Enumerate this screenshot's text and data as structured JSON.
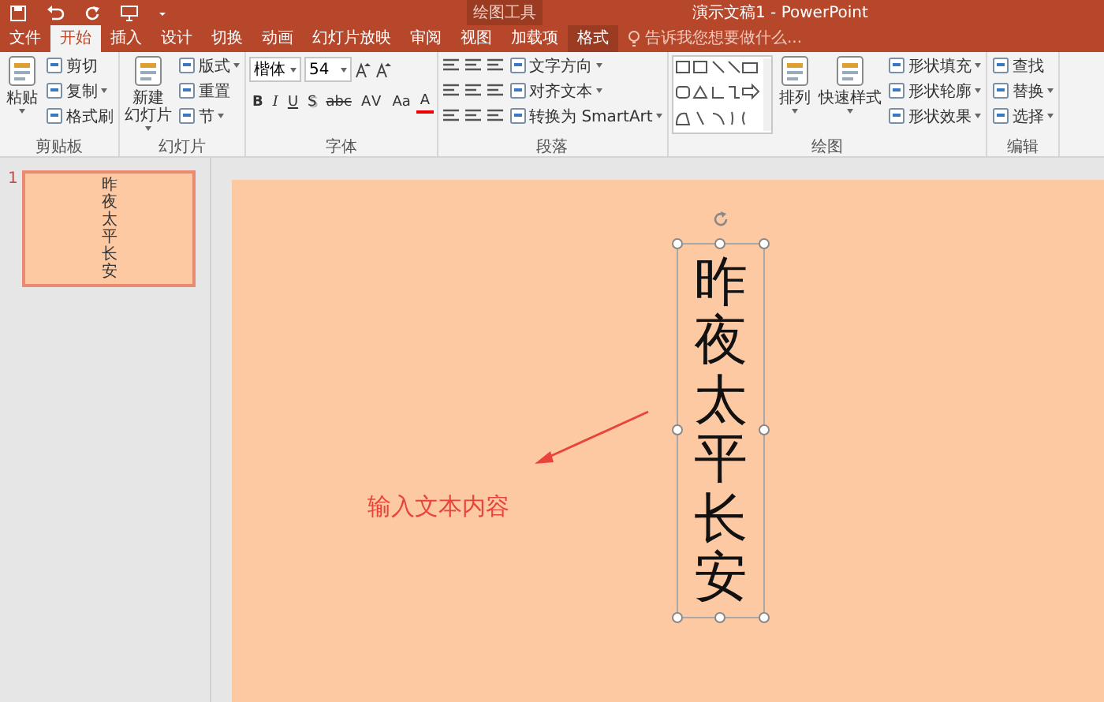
{
  "title_bar": {
    "contextual_label": "绘图工具",
    "title": "演示文稿1 - PowerPoint"
  },
  "tabs": [
    {
      "label": "文件",
      "selected": false,
      "contextual": false
    },
    {
      "label": "开始",
      "selected": true,
      "contextual": false
    },
    {
      "label": "插入",
      "selected": false,
      "contextual": false
    },
    {
      "label": "设计",
      "selected": false,
      "contextual": false
    },
    {
      "label": "切换",
      "selected": false,
      "contextual": false
    },
    {
      "label": "动画",
      "selected": false,
      "contextual": false
    },
    {
      "label": "幻灯片放映",
      "selected": false,
      "contextual": false
    },
    {
      "label": "审阅",
      "selected": false,
      "contextual": false
    },
    {
      "label": "视图",
      "selected": false,
      "contextual": false
    },
    {
      "label": "加载项",
      "selected": false,
      "contextual": false
    },
    {
      "label": "格式",
      "selected": false,
      "contextual": true
    }
  ],
  "search": {
    "placeholder": "告诉我您想要做什么..."
  },
  "ribbon": {
    "groups": [
      {
        "label": "剪贴板",
        "kind": "columns",
        "columns": [
          [
            {
              "kind": "large",
              "lines": [
                "粘贴"
              ],
              "dropdown": true
            }
          ],
          [
            {
              "kind": "small",
              "label": "剪切",
              "dropdown": false
            },
            {
              "kind": "small",
              "label": "复制",
              "dropdown": true
            },
            {
              "kind": "small",
              "label": "格式刷",
              "dropdown": false
            }
          ]
        ]
      },
      {
        "label": "幻灯片",
        "kind": "columns",
        "columns": [
          [
            {
              "kind": "large",
              "lines": [
                "新建",
                "幻灯片"
              ],
              "dropdown": true
            }
          ],
          [
            {
              "kind": "small",
              "label": "版式",
              "dropdown": true
            },
            {
              "kind": "small",
              "label": "重置",
              "dropdown": false
            },
            {
              "kind": "small",
              "label": "节",
              "dropdown": true
            }
          ]
        ]
      },
      {
        "label": "字体",
        "kind": "lines",
        "upper": [
          {
            "kind": "field",
            "label": "楷体",
            "dropdown": true
          },
          {
            "kind": "field",
            "label": "54",
            "dropdown": true
          },
          {
            "kind": "icons"
          }
        ],
        "lower": [
          {
            "kind": "bold",
            "label": "B"
          },
          {
            "kind": "italic",
            "label": "I"
          },
          {
            "kind": "underline",
            "label": "U"
          },
          {
            "kind": "shadow",
            "label": "S"
          },
          {
            "kind": "strike",
            "label": "abc"
          },
          {
            "kind": "spacing",
            "label": "AV"
          },
          {
            "kind": "plain",
            "label": "Aa"
          },
          {
            "kind": "color",
            "label": "A"
          }
        ]
      },
      {
        "label": "段落",
        "kind": "columns",
        "columns": [
          [
            {
              "kind": "icons"
            },
            {
              "kind": "icons"
            },
            {
              "kind": "icons"
            }
          ],
          [
            {
              "kind": "small",
              "label": "文字方向",
              "dropdown": true
            },
            {
              "kind": "small",
              "label": "对齐文本",
              "dropdown": true
            },
            {
              "kind": "small",
              "label": "转换为 SmartArt",
              "dropdown": true
            }
          ]
        ]
      },
      {
        "label": "绘图",
        "kind": "columns",
        "columns": [
          [
            {
              "kind": "gallery"
            }
          ],
          [
            {
              "kind": "large",
              "lines": [
                "排列"
              ],
              "dropdown": true
            }
          ],
          [
            {
              "kind": "large",
              "lines": [
                "快速样式"
              ],
              "dropdown": true
            }
          ],
          [
            {
              "kind": "small",
              "label": "形状填充",
              "dropdown": true
            },
            {
              "kind": "small",
              "label": "形状轮廓",
              "dropdown": true
            },
            {
              "kind": "small",
              "label": "形状效果",
              "dropdown": true
            }
          ]
        ]
      },
      {
        "label": "编辑",
        "kind": "columns",
        "columns": [
          [
            {
              "kind": "small",
              "label": "查找",
              "dropdown": false
            },
            {
              "kind": "small",
              "label": "替换",
              "dropdown": true
            },
            {
              "kind": "small",
              "label": "选择",
              "dropdown": true
            }
          ]
        ]
      }
    ]
  },
  "thumbnails": [
    {
      "number": "1",
      "text": "昨夜太平长安",
      "selected": true
    }
  ],
  "slide": {
    "text_box": {
      "text": "昨夜太平长安",
      "selected": true
    },
    "annotation": "输入文本内容"
  }
}
